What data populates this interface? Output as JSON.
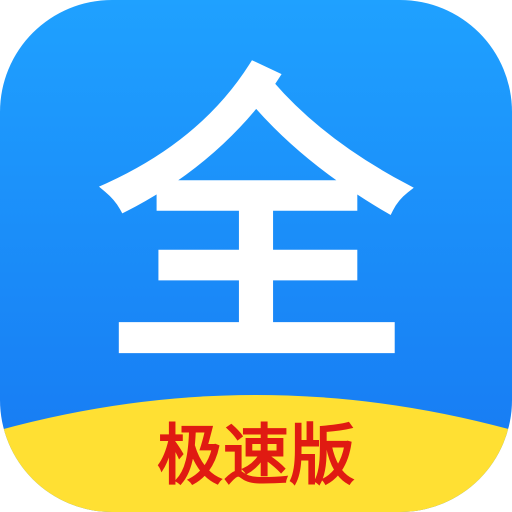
{
  "icon": {
    "glyph": "全",
    "badge_label": "极速版",
    "colors": {
      "background_top": "#1FA1FF",
      "background_bottom": "#1677F2",
      "glyph": "#FFFFFF",
      "badge_band": "#FFE033",
      "badge_text": "#E01A12"
    }
  }
}
